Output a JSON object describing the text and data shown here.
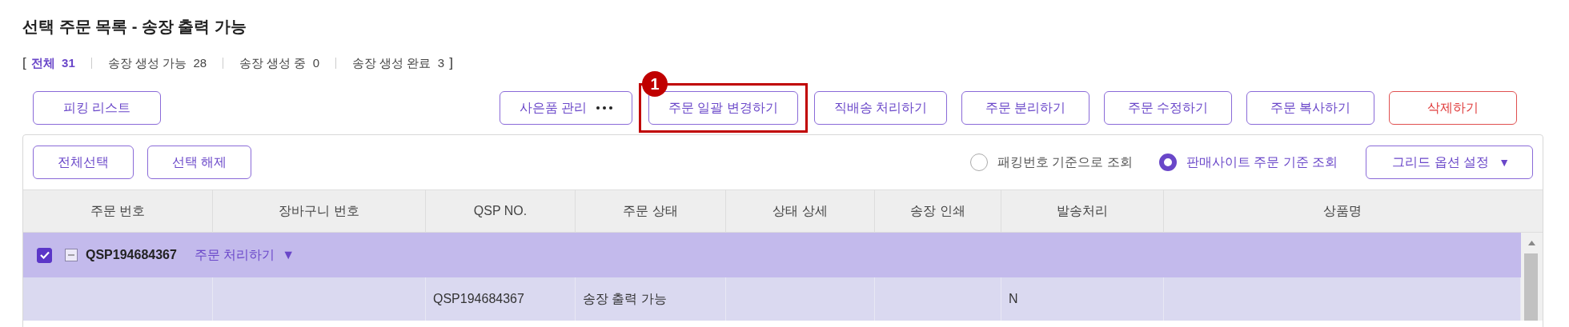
{
  "title": "선택 주문 목록 - 송장 출력 가능",
  "filter": {
    "open": "[",
    "close": "]",
    "tabs": [
      {
        "label": "전체",
        "count": "31",
        "selected": true
      },
      {
        "label": "송장 생성 가능",
        "count": "28",
        "selected": false
      },
      {
        "label": "송장 생성 중",
        "count": "0",
        "selected": false
      },
      {
        "label": "송장 생성 완료",
        "count": "3",
        "selected": false
      }
    ]
  },
  "toolbar": {
    "left": [
      {
        "label": "피킹 리스트"
      }
    ],
    "right": [
      {
        "label": "사은품 관리",
        "kind": "more",
        "highlighted": false
      },
      {
        "label": "주문 일괄 변경하기",
        "kind": "normal",
        "highlighted": true,
        "callout": "1"
      },
      {
        "label": "직배송 처리하기",
        "kind": "normal",
        "highlighted": false
      },
      {
        "label": "주문 분리하기",
        "kind": "normal",
        "highlighted": false
      },
      {
        "label": "주문 수정하기",
        "kind": "normal",
        "highlighted": false
      },
      {
        "label": "주문 복사하기",
        "kind": "normal",
        "highlighted": false
      },
      {
        "label": "삭제하기",
        "kind": "danger",
        "highlighted": false
      }
    ]
  },
  "grid": {
    "select_buttons": [
      "전체선택",
      "선택 해제"
    ],
    "view_options": [
      {
        "label": "패킹번호 기준으로 조회",
        "selected": false
      },
      {
        "label": "판매사이트 주문 기준 조회",
        "selected": true
      }
    ],
    "options_button": {
      "label": "그리드 옵션 설정",
      "caret": "▼"
    },
    "columns": [
      "주문 번호",
      "장바구니 번호",
      "QSP NO.",
      "주문 상태",
      "상태 상세",
      "송장 인쇄",
      "발송처리",
      "상품명"
    ],
    "groups": [
      {
        "checked": true,
        "expanded": true,
        "order_no": "QSP194684367",
        "action": "주문 처리하기",
        "action_caret": "▼",
        "rows": [
          {
            "column_3": "QSP194684367",
            "column_4": "송장 출력 가능",
            "column_7": "N"
          }
        ]
      }
    ]
  }
}
